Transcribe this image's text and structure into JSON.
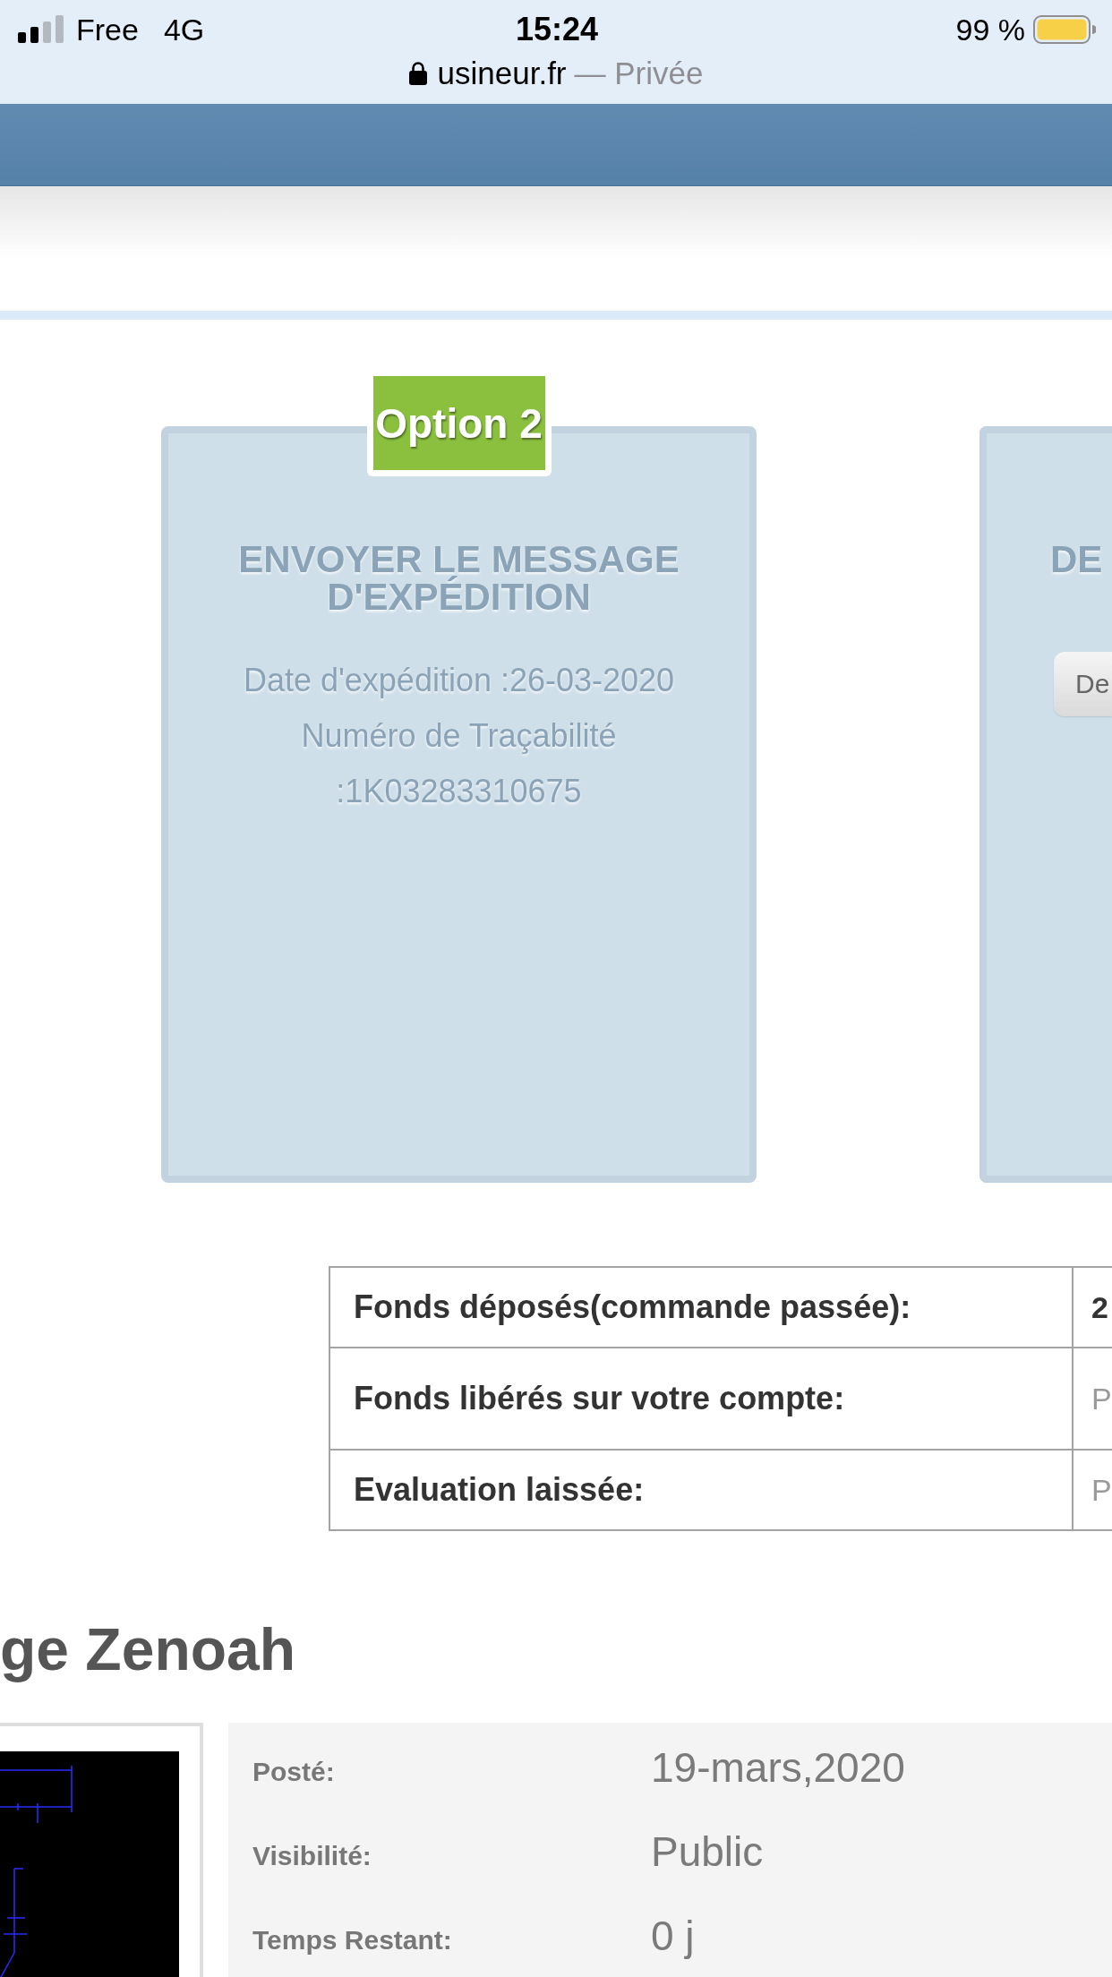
{
  "status_bar": {
    "carrier": "Free",
    "network": "4G",
    "time": "15:24",
    "battery": "99 %",
    "url": "usineur.fr",
    "browsing_mode": "— Privée"
  },
  "cards": [
    {
      "badge": "Option 2",
      "title": "ENVOYER LE MESSAGE D'EXPÉDITION",
      "lines": [
        "Date d'expédition :26-03-2020",
        "Numéro de Traçabilité :1K03283310675"
      ]
    },
    {
      "title": "DE",
      "button": "De"
    }
  ],
  "summary": [
    {
      "label": "Fonds déposés(commande passée):",
      "value": "2",
      "kind": "strong"
    },
    {
      "label": "Fonds libérés sur votre compte:",
      "value": "P",
      "kind": "muted"
    },
    {
      "label": "Evaluation laissée:",
      "value": "P",
      "kind": "muted"
    }
  ],
  "heading": "ge Zenoah",
  "details": [
    {
      "label": "Posté:",
      "value": "19-mars,2020"
    },
    {
      "label": "Visibilité:",
      "value": "Public"
    },
    {
      "label": "Temps Restant:",
      "value": "0 j"
    }
  ]
}
